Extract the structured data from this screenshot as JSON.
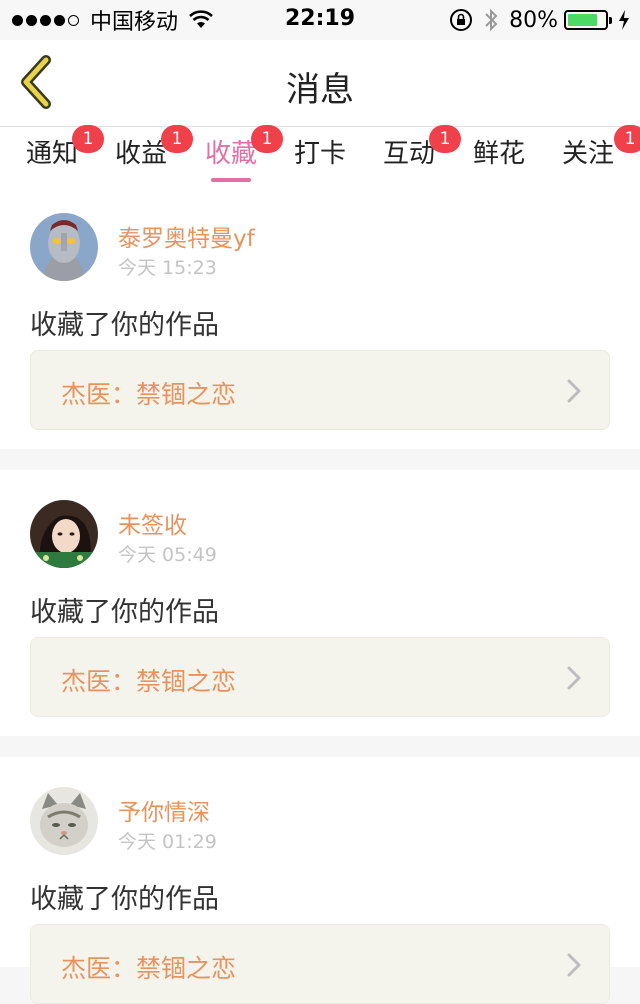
{
  "status_bar": {
    "carrier": "中国移动",
    "time": "22:19",
    "battery_percent": "80%",
    "battery_level": 0.8,
    "icons": [
      "signal-dots-icon",
      "wifi-icon",
      "orientation-lock-icon",
      "bluetooth-icon",
      "battery-icon",
      "charging-bolt-icon"
    ]
  },
  "nav": {
    "title": "消息",
    "back_icon": "chevron-left-icon"
  },
  "tabs": [
    {
      "label": "通知",
      "badge": "1"
    },
    {
      "label": "收益",
      "badge": "1"
    },
    {
      "label": "收藏",
      "badge": "1",
      "active": true
    },
    {
      "label": "打卡",
      "badge": ""
    },
    {
      "label": "互动",
      "badge": "1"
    },
    {
      "label": "鲜花",
      "badge": ""
    },
    {
      "label": "关注",
      "badge": "1"
    }
  ],
  "messages": [
    {
      "username": "泰罗奥特曼yf",
      "time": "今天 15:23",
      "action": "收藏了你的作品",
      "work_title": "杰医：禁锢之恋"
    },
    {
      "username": "未签收",
      "time": "今天 05:49",
      "action": "收藏了你的作品",
      "work_title": "杰医：禁锢之恋"
    },
    {
      "username": "予你情深",
      "time": "今天 01:29",
      "action": "收藏了你的作品",
      "work_title": "杰医：禁锢之恋"
    }
  ],
  "colors": {
    "accent_pink": "#e36fa6",
    "username_orange": "#e8935e",
    "badge_red": "#f0404a",
    "back_arrow_yellow": "#e8d44a",
    "battery_green": "#4cd964"
  }
}
